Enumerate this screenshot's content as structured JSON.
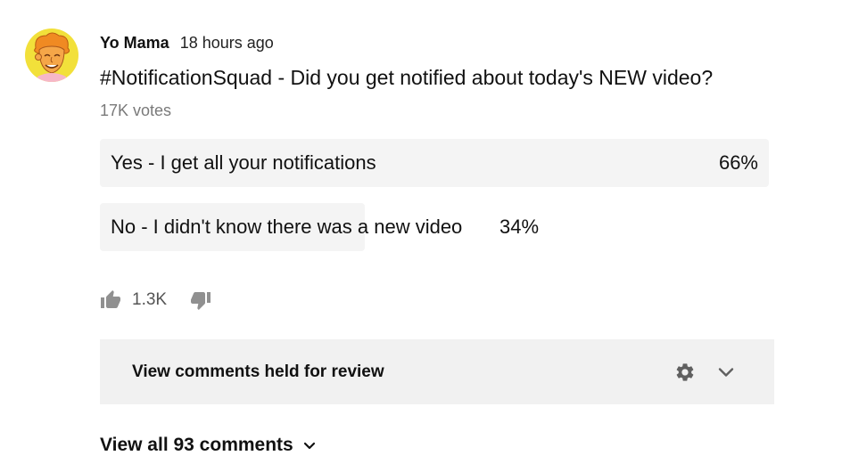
{
  "post": {
    "author": "Yo Mama",
    "time": "18 hours ago",
    "question": "#NotificationSquad - Did you get notified about today's NEW video?",
    "votes": "17K votes"
  },
  "poll": {
    "options": [
      {
        "label": "Yes - I get all your notifications",
        "percent": "66%",
        "share": 66
      },
      {
        "label": "No - I didn't know there was a new video",
        "percent": "34%",
        "share": 34
      }
    ]
  },
  "actions": {
    "like_count": "1.3K",
    "like_icon": "thumbs-up-icon",
    "dislike_icon": "thumbs-down-icon"
  },
  "review": {
    "label": "View comments held for review",
    "gear_icon": "gear-icon",
    "chevron_icon": "chevron-down-icon"
  },
  "comments": {
    "view_all_label": "View all 93 comments",
    "chevron_icon": "chevron-down-icon"
  },
  "colors": {
    "option_fill": "#f4f4f4",
    "review_bg": "#f1f1f1",
    "muted_text": "#7a7a7a",
    "avatar_bg": "#f2e03a"
  }
}
